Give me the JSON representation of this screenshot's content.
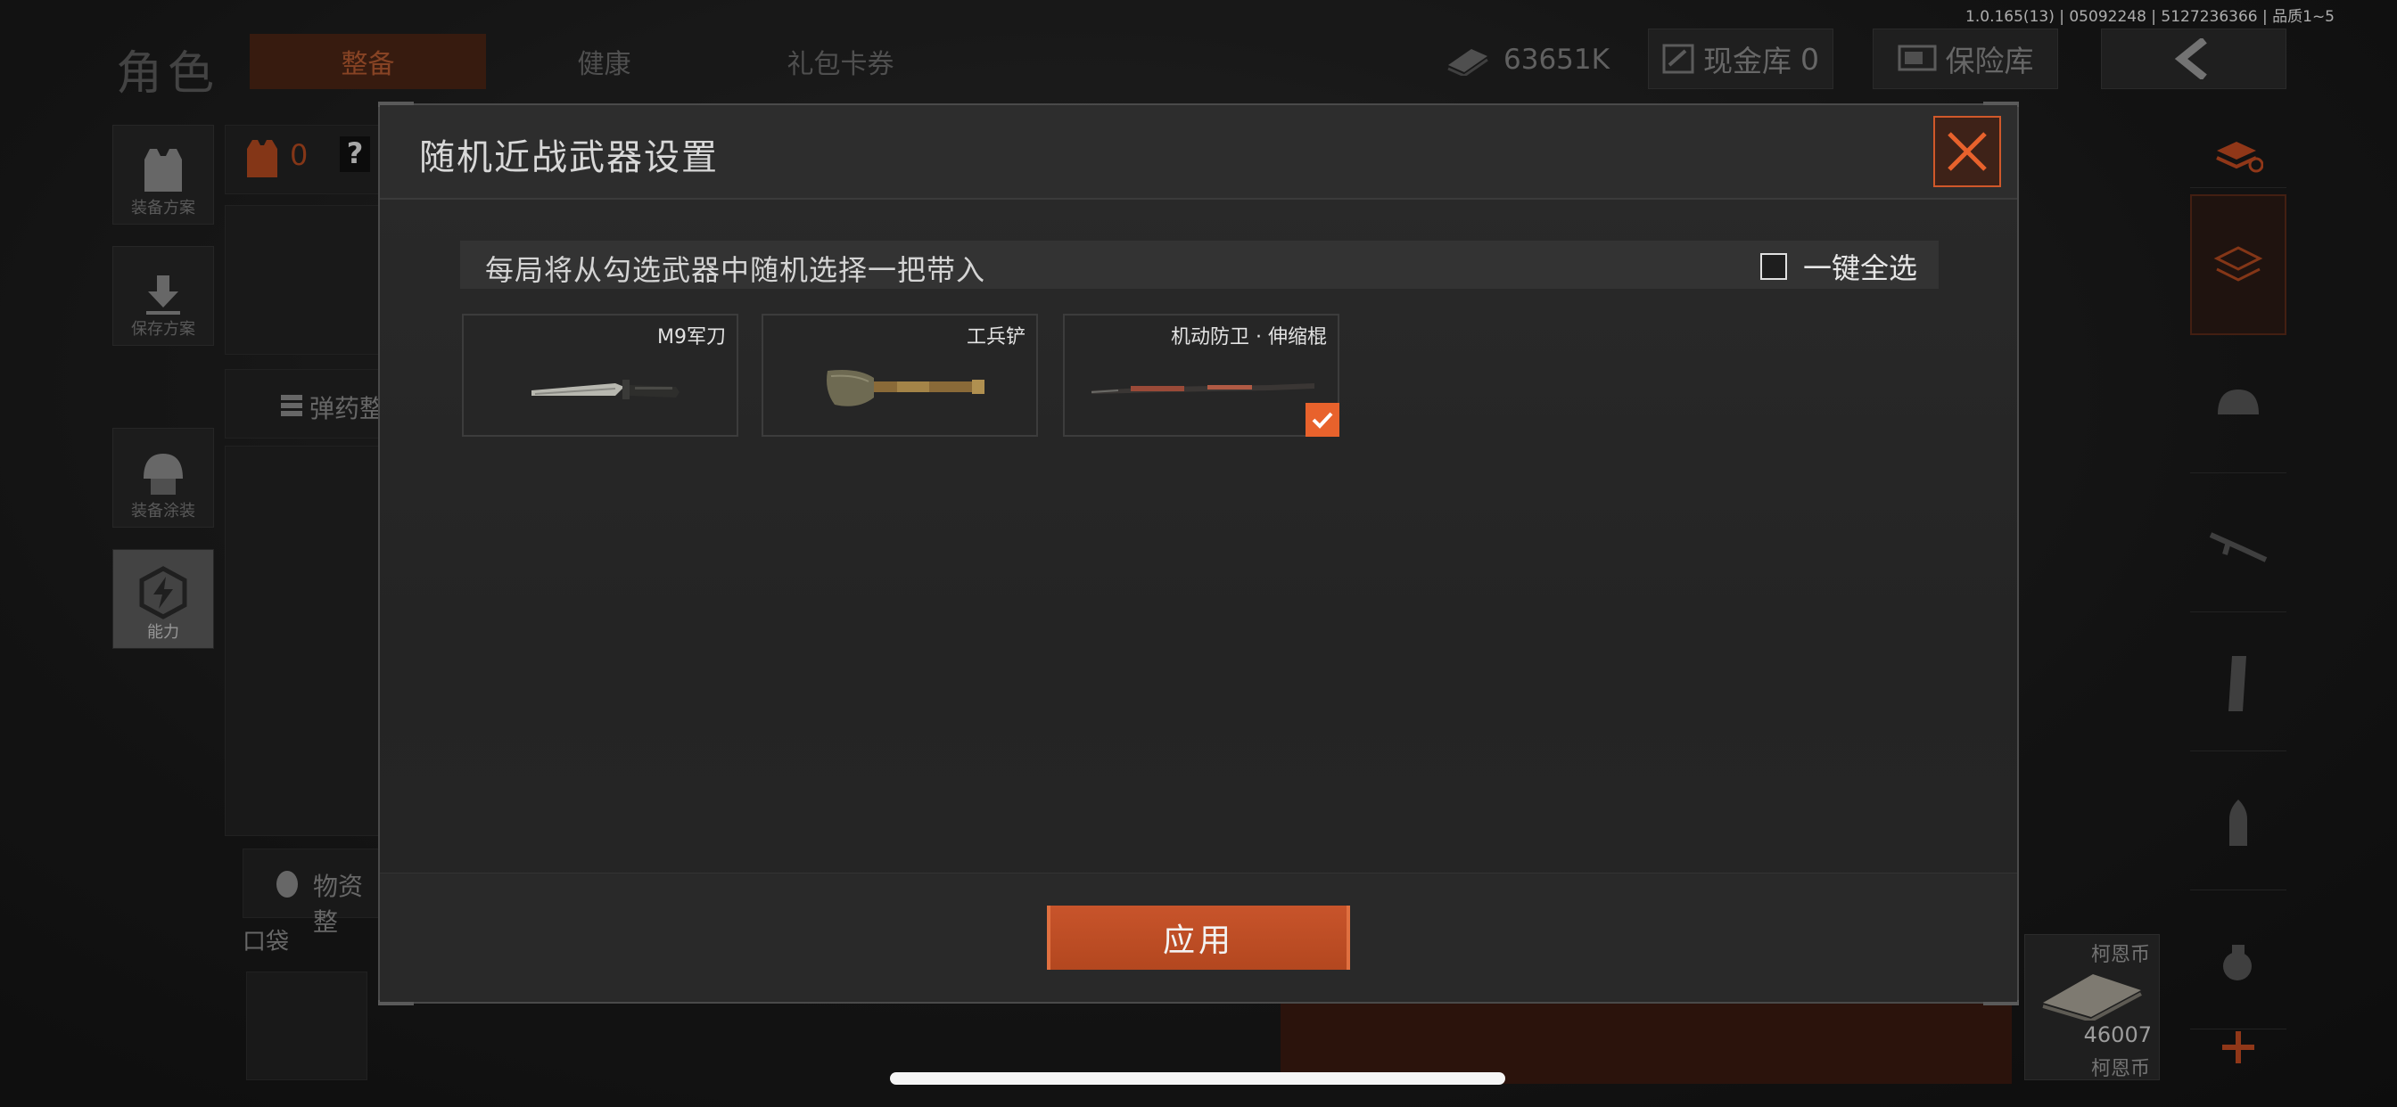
{
  "header": {
    "version_text": "1.0.165(13) | 05092248 | 5127236366 | 品质1~5",
    "page_title": "角色",
    "tabs": [
      {
        "label": "整备",
        "active": true
      },
      {
        "label": "健康",
        "active": false
      },
      {
        "label": "礼包卡券",
        "active": false
      }
    ],
    "currency_value": "63651K",
    "cash_vault_label": "现金库",
    "cash_vault_value": "0",
    "safe_vault_label": "保险库"
  },
  "left_sidebar": {
    "items": [
      {
        "label": "装备方案",
        "icon": "vest-icon"
      },
      {
        "label": "保存方案",
        "icon": "download-icon"
      },
      {
        "label": "装备涂装",
        "icon": "helmet-icon"
      },
      {
        "label": "能力",
        "icon": "lightning-hex-icon",
        "active": true
      }
    ]
  },
  "background_panel": {
    "vest_count": "0",
    "help_glyph": "?",
    "ammo_section": "弹药整",
    "supplies_section": "物资整",
    "pocket_label": "口袋",
    "coin_label_1": "柯恩币",
    "coin_value": "46007",
    "coin_label_2": "柯恩币"
  },
  "modal": {
    "title": "随机近战武器设置",
    "instruction": "每局将从勾选武器中随机选择一把带入",
    "select_all_label": "一键全选",
    "select_all_checked": false,
    "weapons": [
      {
        "name": "M9军刀",
        "icon": "bayonet-knife-icon",
        "checked": false
      },
      {
        "name": "工兵铲",
        "icon": "shovel-icon",
        "checked": false
      },
      {
        "name": "机动防卫 · 伸缩棍",
        "icon": "baton-icon",
        "checked": true
      }
    ],
    "apply_label": "应用"
  },
  "colors": {
    "accent": "#e8622c",
    "accent_dark": "#b3471f",
    "panel": "#2a2a2a",
    "text": "#d8d8d8"
  }
}
